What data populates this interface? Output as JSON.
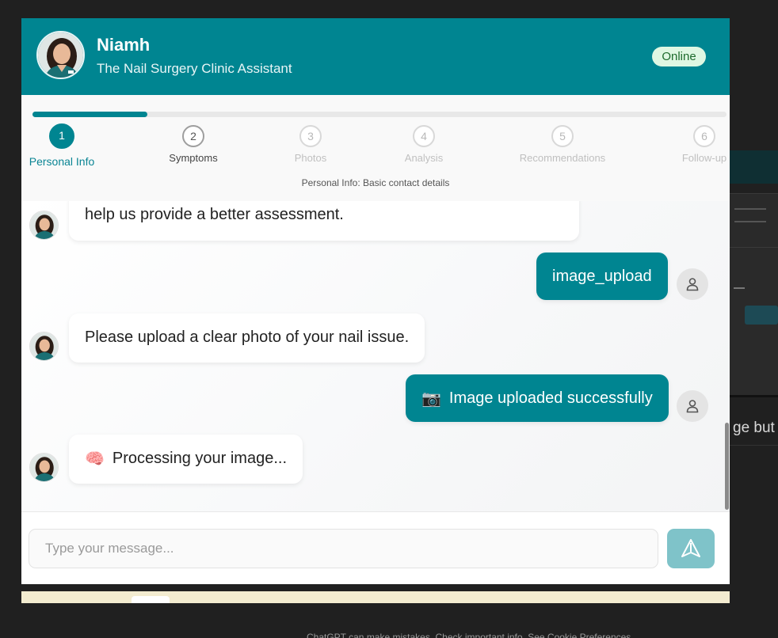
{
  "header": {
    "name": "Niamh",
    "subtitle": "The Nail Surgery Clinic Assistant",
    "status": "Online"
  },
  "progress": {
    "fraction": 0.166,
    "steps": [
      {
        "number": "1",
        "label": "Personal Info"
      },
      {
        "number": "2",
        "label": "Symptoms"
      },
      {
        "number": "3",
        "label": "Photos"
      },
      {
        "number": "4",
        "label": "Analysis"
      },
      {
        "number": "5",
        "label": "Recommendations"
      },
      {
        "number": "6",
        "label": "Follow-up"
      }
    ],
    "caption": "Personal Info: Basic contact details"
  },
  "messages": [
    {
      "from": "bot",
      "text": "help us provide a better assessment."
    },
    {
      "from": "user",
      "text": "image_upload"
    },
    {
      "from": "bot",
      "text": "Please upload a clear photo of your nail issue."
    },
    {
      "from": "user",
      "emoji": "📷",
      "text": "Image uploaded successfully"
    },
    {
      "from": "bot",
      "emoji": "🧠",
      "text": "Processing your image..."
    }
  ],
  "composer": {
    "placeholder": "Type your message..."
  },
  "background": {
    "partial_text": "ge but",
    "footer_caption": "ChatGPT can make mistakes. Check important info. See Cookie Preferences."
  },
  "colors": {
    "brand": "#008591",
    "send_button": "#7fc3c9",
    "status_badge": "#dff7e3"
  }
}
